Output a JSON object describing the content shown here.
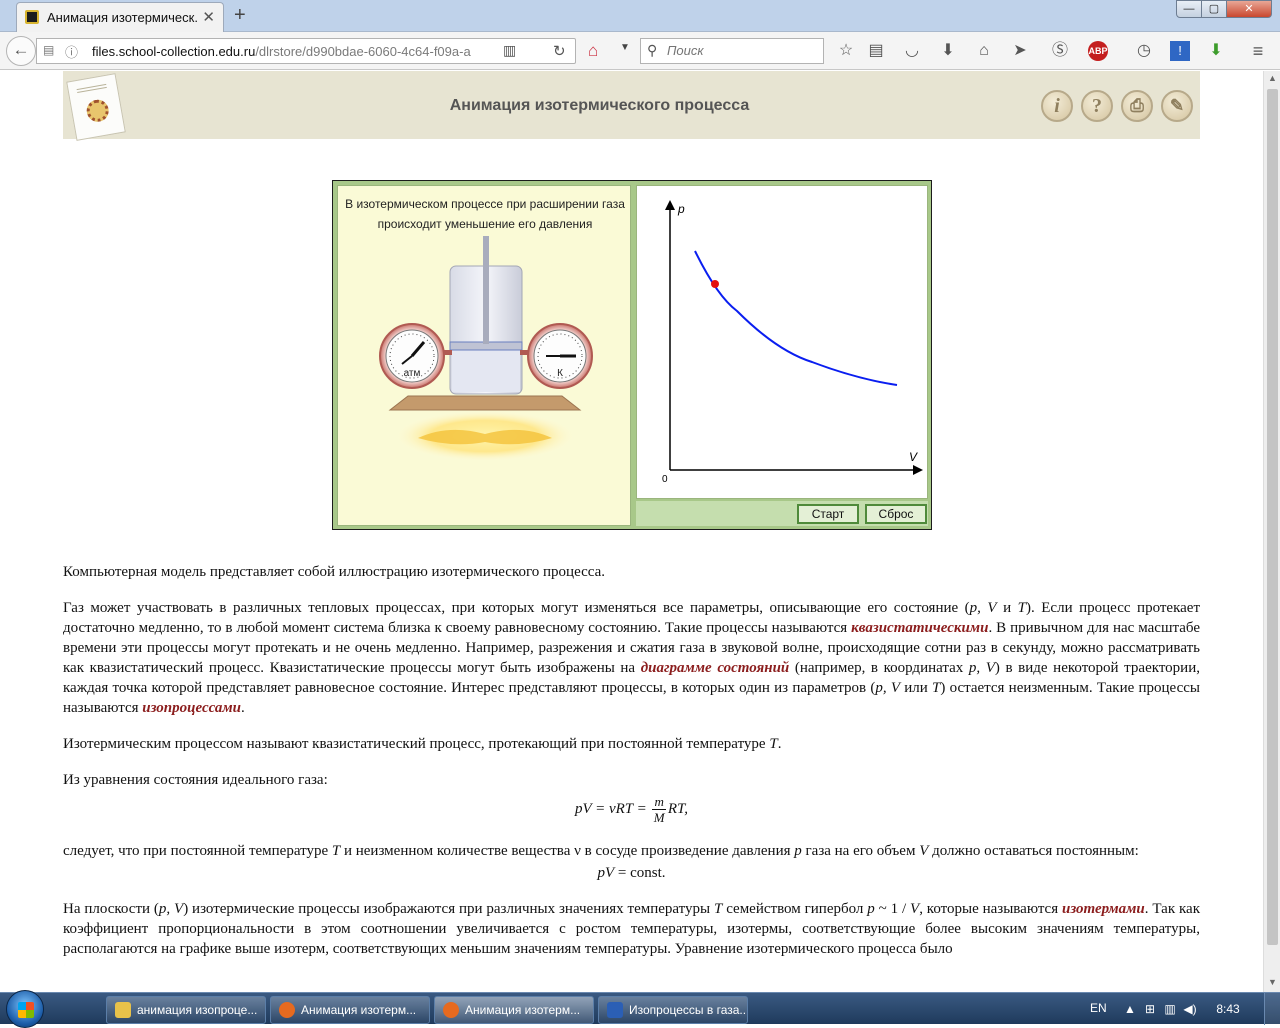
{
  "browser": {
    "tab_title": "Анимация изотермическ...",
    "new_tab": "+",
    "tab_close": "✕",
    "url_domain": "files.school-collection.edu.ru",
    "url_path": "/dlrstore/d990bdae-6060-4c64-f09a-a",
    "search_placeholder": "Поиск"
  },
  "header": {
    "title": "Анимация изотермического процесса",
    "buttons": [
      "i",
      "?",
      "⎙",
      "✎"
    ]
  },
  "animation": {
    "caption": "В изотермическом процессе при расширении газа происходит уменьшение его давления",
    "gauge_left_label": "атм",
    "gauge_right_label": "К",
    "graph_p_label": "p",
    "graph_v_label": "V",
    "graph_origin_label": "0",
    "start_label": "Старт",
    "reset_label": "Сброс"
  },
  "article": {
    "p1": "Компьютерная модель представляет собой иллюстрацию изотермического процесса.",
    "p2_a": "Газ может участвовать в различных тепловых процессах, при которых могут изменяться все параметры, описывающие его состояние (",
    "p2_vars": "p, V",
    "p2_and": " и ",
    "p2_T": "T",
    "p2_b": "). Если процесс протекает достаточно медленно, то в любой момент система близка к своему равновесному состоянию. Такие процессы называются ",
    "term_quasistatic": "квазистатическими",
    "p2_c": ". В привычном для нас масштабе времени эти процессы могут протекать и не очень медленно. Например, разрежения и сжатия газа в звуковой волне, происходящие сотни раз в секунду, можно рассматривать как квазистатический процесс. Квазистатические процессы могут быть изображены на ",
    "term_diagram": "диаграмме состояний",
    "p2_d": " (например, в координатах ",
    "p2_pV": "p, V",
    "p2_e": ") в виде некоторой траектории, каждая точка которой представляет равновесное состояние. Интерес представляют процессы, в которых один из параметров (",
    "p2_vars2": "p, V",
    "p2_or": " или ",
    "p2_T2": "T",
    "p2_f": ") остается неизменным. Такие процессы называются ",
    "term_isoprocess": "изопроцессами",
    "p2_g": ".",
    "p3_a": "Изотермическим процессом называют квазистатический процесс, протекающий при постоянной температуре ",
    "p3_T": "T",
    "p3_b": ".",
    "p4": "Из уравнения состояния идеального газа:",
    "formula1_left": "pV = νRT = ",
    "formula1_num": "m",
    "formula1_den": "M",
    "formula1_right": "RT,",
    "p5_a": "следует, что при постоянной температуре ",
    "p5_T": "T",
    "p5_b": " и неизменном количестве вещества ν в сосуде произведение давления ",
    "p5_p": "p",
    "p5_c": " газа на его объем ",
    "p5_V": "V",
    "p5_d": " должно оставаться постоянным:",
    "formula2_pV": "pV",
    "formula2_rest": " = const.",
    "p6_a": "На плоскости (",
    "p6_pV": "p, V",
    "p6_b": ") изотермические процессы изображаются при различных значениях температуры ",
    "p6_T": "T",
    "p6_c": " семейством гипербол ",
    "p6_p": "p",
    "p6_d": " ~ 1 / ",
    "p6_V": "V",
    "p6_e": ", которые называются ",
    "term_isotherms": "изотермами",
    "p6_f": ". Так как коэффициент пропорциональности в этом соотношении увеличивается с ростом температуры, изотермы, соответствующие более высоким значениям температуры, располагаются на графике выше изотерм, соответствующих меньшим значениям температуры. Уравнение изотермического процесса было"
  },
  "taskbar": {
    "tasks": [
      {
        "label": "анимация изопроце...",
        "icon_color": "#e8c24a"
      },
      {
        "label": "Анимация изотерм...",
        "icon_color": "#e66a1f"
      },
      {
        "label": "Анимация изотерм...",
        "icon_color": "#e66a1f"
      },
      {
        "label": "Изопроцессы в газа...",
        "icon_color": "#2b5fb5"
      }
    ],
    "lang": "EN",
    "time": "8:43"
  }
}
